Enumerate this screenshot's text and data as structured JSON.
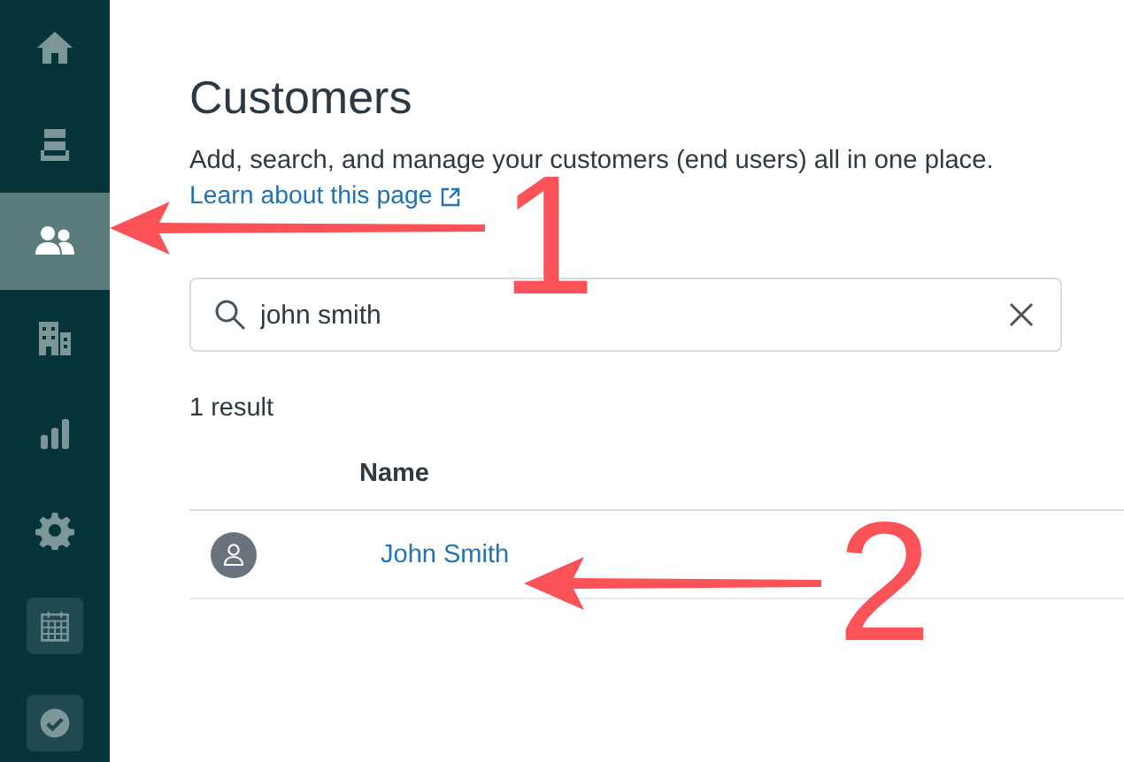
{
  "sidebar": {
    "items": [
      {
        "kind": "plain",
        "selected": false
      },
      {
        "kind": "plain",
        "selected": false
      },
      {
        "kind": "plain",
        "selected": true
      },
      {
        "kind": "plain",
        "selected": false
      },
      {
        "kind": "plain",
        "selected": false
      },
      {
        "kind": "plain",
        "selected": false
      },
      {
        "kind": "tile",
        "selected": false
      },
      {
        "kind": "tile",
        "selected": false
      }
    ]
  },
  "page": {
    "title": "Customers",
    "description": "Add, search, and manage your customers (end users) all in one place.",
    "link": "Learn about this page"
  },
  "search": {
    "value": "john smith"
  },
  "result_count": "1 result",
  "table": {
    "columns": [
      "Name"
    ],
    "rows": [
      {
        "name": "John Smith"
      }
    ]
  },
  "annotations": [
    {
      "label": "1"
    },
    {
      "label": "2"
    }
  ]
}
